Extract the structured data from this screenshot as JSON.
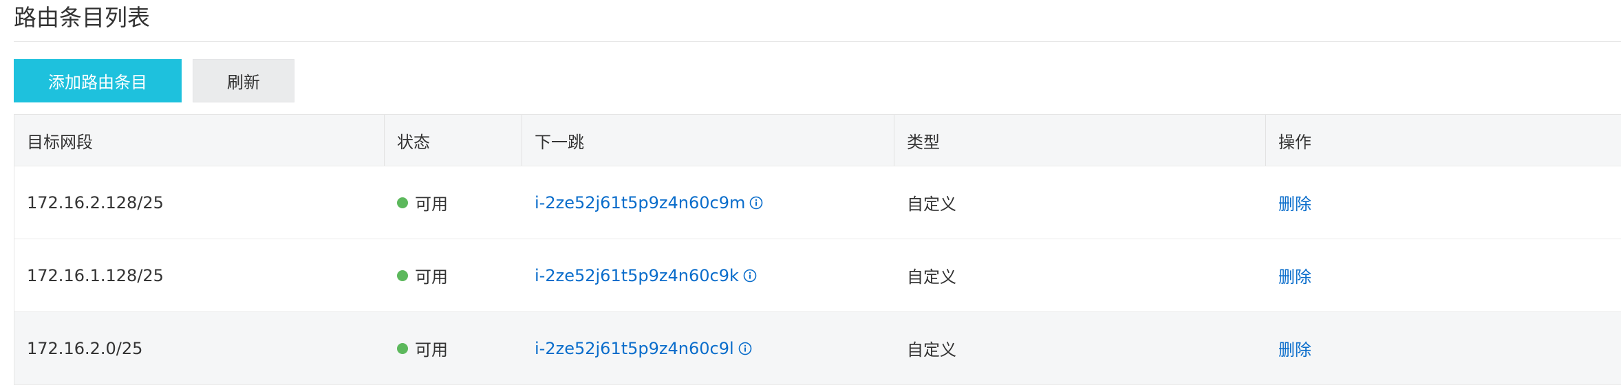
{
  "page": {
    "title": "路由条目列表"
  },
  "toolbar": {
    "add_label": "添加路由条目",
    "refresh_label": "刷新"
  },
  "colors": {
    "primary": "#1ec1dd",
    "link": "#0a6dcb",
    "status_ok": "#5cb85c"
  },
  "table": {
    "columns": [
      "目标网段",
      "状态",
      "下一跳",
      "类型",
      "操作"
    ],
    "rows": [
      {
        "cidr": "172.16.2.128/25",
        "status": "可用",
        "next_hop": "i-2ze52j61t5p9z4n60c9m",
        "type": "自定义",
        "action": "删除"
      },
      {
        "cidr": "172.16.1.128/25",
        "status": "可用",
        "next_hop": "i-2ze52j61t5p9z4n60c9k",
        "type": "自定义",
        "action": "删除"
      },
      {
        "cidr": "172.16.2.0/25",
        "status": "可用",
        "next_hop": "i-2ze52j61t5p9z4n60c9l",
        "type": "自定义",
        "action": "删除"
      }
    ]
  },
  "icons": {
    "status": "status-dot-icon",
    "info": "info-icon"
  }
}
